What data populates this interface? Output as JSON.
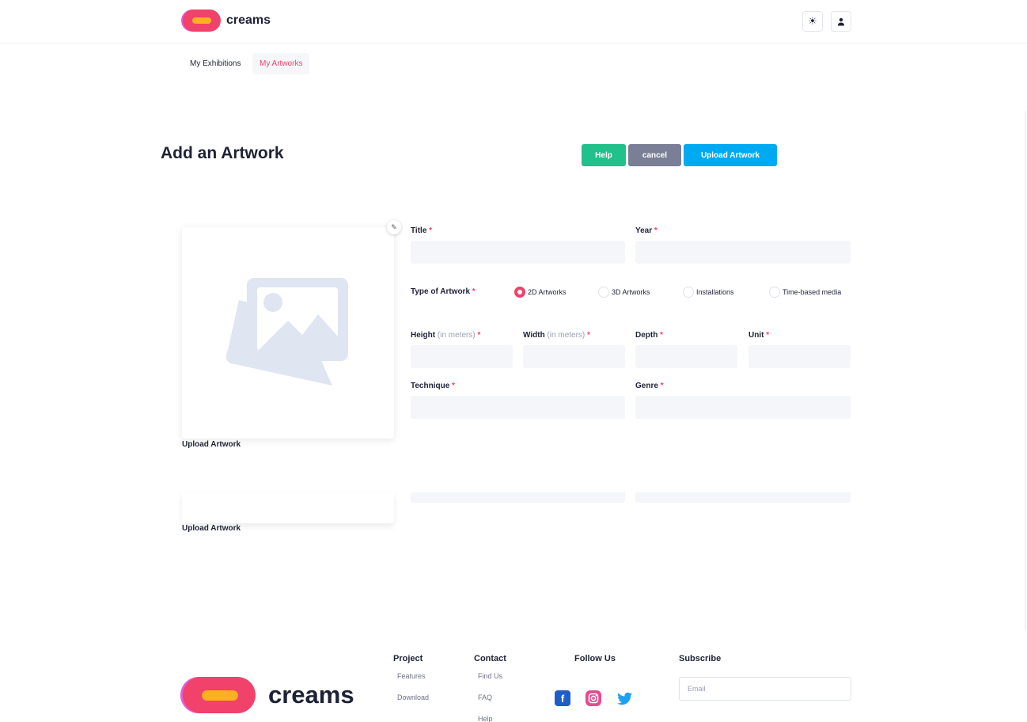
{
  "header": {
    "brand": "creams",
    "theme_icon": "sun-icon",
    "user_icon": "user-icon"
  },
  "tabs": [
    {
      "label": "My Exhibitions",
      "active": false
    },
    {
      "label": "My Artworks",
      "active": true
    }
  ],
  "page": {
    "title": "Add an Artwork"
  },
  "actions": {
    "help": "Help",
    "cancel": "cancel",
    "upload": "Upload Artwork"
  },
  "artwork_image": {
    "caption": "Upload Artwork",
    "caption_repeat": "Upload Artwork",
    "placeholder_icon": "image-placeholder-icon",
    "edit_icon": "pencil-icon"
  },
  "form": {
    "title_label": "Title",
    "year_label": "Year",
    "type_label": "Type of Artwork",
    "required_mark": "*",
    "types": [
      "2D Artworks",
      "3D Artworks",
      "Installations",
      "Time-based media"
    ],
    "selected_type": "2D Artworks",
    "height_label": "Height",
    "width_label": "Width",
    "unit_hint": "(in meters)",
    "depth_label": "Depth",
    "unit_label": "Unit",
    "technique_label": "Technique",
    "genre_label": "Genre"
  },
  "footer": {
    "brand": "creams",
    "project": {
      "heading": "Project",
      "links": [
        "Features",
        "Download"
      ]
    },
    "contact": {
      "heading": "Contact",
      "links": [
        "Find Us",
        "FAQ",
        "Help"
      ]
    },
    "follow": {
      "heading": "Follow Us",
      "icons": [
        "facebook-icon",
        "instagram-icon",
        "twitter-icon"
      ]
    },
    "subscribe": {
      "heading": "Subscribe",
      "placeholder": "Email"
    }
  },
  "colors": {
    "accent": "#f0426a",
    "help": "#22c08a",
    "cancel": "#7a7f95",
    "upload": "#00aaf2"
  }
}
